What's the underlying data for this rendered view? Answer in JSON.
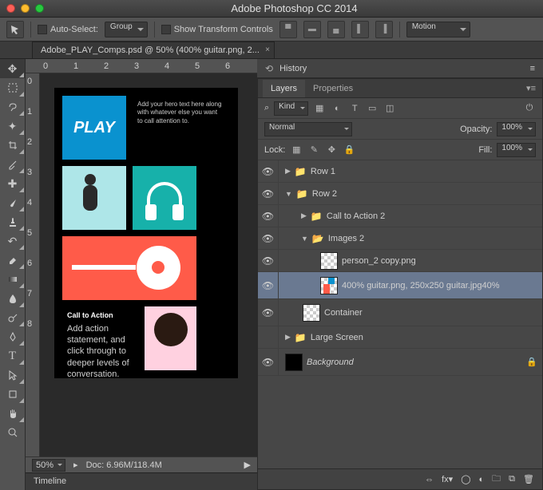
{
  "app_title": "Adobe Photoshop CC 2014",
  "options": {
    "auto_select_label": "Auto-Select:",
    "auto_select_value": "Group",
    "show_transform_label": "Show Transform Controls",
    "workspace": "Motion"
  },
  "doc_tab": "Adobe_PLAY_Comps.psd @ 50% (400% guitar.png, 2...",
  "rulers_top": [
    "0",
    "1",
    "2",
    "3",
    "4",
    "5",
    "6"
  ],
  "rulers_left": [
    "0",
    "1",
    "2",
    "3",
    "4",
    "5",
    "6",
    "7",
    "8"
  ],
  "canvas": {
    "play_text": "PLAY",
    "hero_text": "Add your hero text here along with whatever else you want to call attention to.",
    "cta_title": "Call to Action",
    "cta_body": "Add action statement, and click through to deeper levels of conversation."
  },
  "status": {
    "zoom": "50%",
    "doc": "Doc: 6.96M/118.4M"
  },
  "timeline_label": "Timeline",
  "history_label": "History",
  "panel_tabs": {
    "layers": "Layers",
    "properties": "Properties"
  },
  "filter": {
    "kind_label": "Kind"
  },
  "blend": {
    "mode": "Normal",
    "opacity_label": "Opacity:",
    "opacity": "100%"
  },
  "lock": {
    "label": "Lock:",
    "fill_label": "Fill:",
    "fill": "100%"
  },
  "layers": {
    "row1": "Row 1",
    "row2": "Row 2",
    "cta2": "Call to Action 2",
    "images2": "Images 2",
    "person": "person_2 copy.png",
    "guitar": "400% guitar.png, 250x250 guitar.jpg40%",
    "container": "Container",
    "large": "Large Screen",
    "background": "Background"
  }
}
